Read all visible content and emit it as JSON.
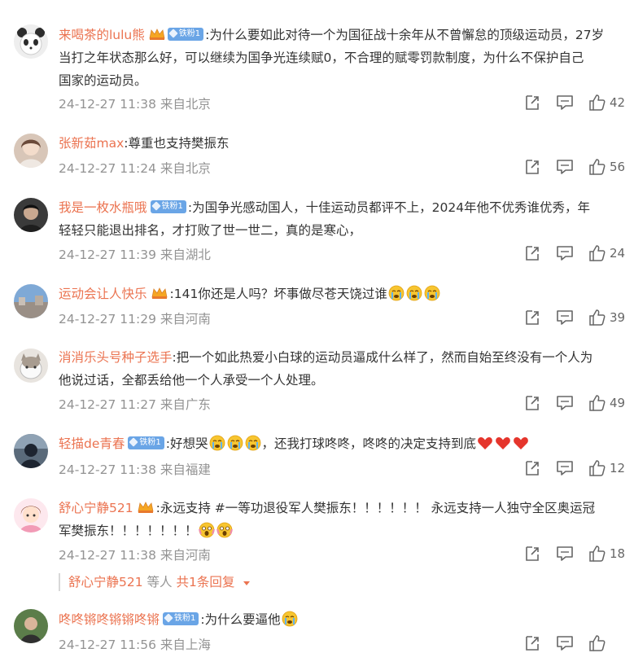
{
  "comments": [
    {
      "user": "来喝茶的lulu熊",
      "badge": "铁粉1",
      "badge_type": "crown-badge",
      "text_lines": [
        ":为什么要如此对待一个为国征战十余年从不曾懈怠的顶级运动员，27岁",
        "当打之年状态那么好，可以继续为国争光连续赋0，不合理的赋零罚款制度，为什么不保护自己",
        "国家的运动员。"
      ],
      "meta": "24-12-27 11:38 来自北京",
      "likes": "42"
    },
    {
      "user": "张新茹max",
      "badge": "",
      "badge_type": "none",
      "text_lines": [
        ":尊重也支持樊振东"
      ],
      "meta": "24-12-27 11:24 来自北京",
      "likes": "56"
    },
    {
      "user": "我是一枚水瓶哦",
      "badge": "铁粉1",
      "badge_type": "fan-badge",
      "text_lines": [
        ":为国争光感动国人，十佳运动员都评不上，2024年他不优秀谁优秀，年",
        "轻轻只能退出排名，才打败了世一世二，真的是寒心，"
      ],
      "meta": "24-12-27 11:39 来自湖北",
      "likes": "24"
    },
    {
      "user": "运动会让人快乐",
      "badge": "",
      "badge_type": "crown",
      "text_lines": [
        ":141你还是人吗？坏事做尽苍天饶过谁"
      ],
      "emojis_after": [
        "crying-emoji",
        "crying-emoji",
        "crying-emoji"
      ],
      "meta": "24-12-27 11:29 来自河南",
      "likes": "39"
    },
    {
      "user": "消消乐头号种子选手",
      "badge": "",
      "badge_type": "none",
      "text_lines": [
        ":把一个如此热爱小白球的运动员逼成什么样了，然而自始至终没有一个人为",
        "他说过话，全都丢给他一个人承受一个人处理。"
      ],
      "meta": "24-12-27 11:27 来自广东",
      "likes": "49"
    },
    {
      "user": "轻描de青春",
      "badge": "铁粉1",
      "badge_type": "fan-badge",
      "text_parts": [
        ":好想哭",
        "，还我打球咚咚，咚咚的决定支持到底"
      ],
      "meta": "24-12-27 11:38 来自福建",
      "likes": "12"
    },
    {
      "user": "舒心宁静521",
      "badge": "",
      "badge_type": "crown",
      "text_lines": [
        ":永远支持 #一等功退役军人樊振东！！！！！！ 永远支持一人独守全区奥运冠",
        "军樊振东！！！！！！！"
      ],
      "meta": "24-12-27 11:38 来自河南",
      "likes": "18",
      "reply": {
        "name": "舒心宁静521",
        "mid": " 等人 ",
        "link": "共1条回复"
      }
    },
    {
      "user": "咚咚锵咚锵锵咚锵",
      "badge": "铁粉1",
      "badge_type": "fan-badge",
      "text_lines": [
        ":为什么要逼他"
      ],
      "meta": "24-12-27 11:56 来自上海",
      "likes": ""
    }
  ],
  "colors": {
    "username": "#eb7350",
    "meta": "#939393",
    "badge": "#6aa5e6",
    "heart": "#e5352c"
  },
  "icons": [
    "share-icon",
    "comment-icon",
    "like-icon",
    "crying-emoji",
    "heart-emoji",
    "shocked-emoji",
    "crown-icon"
  ]
}
